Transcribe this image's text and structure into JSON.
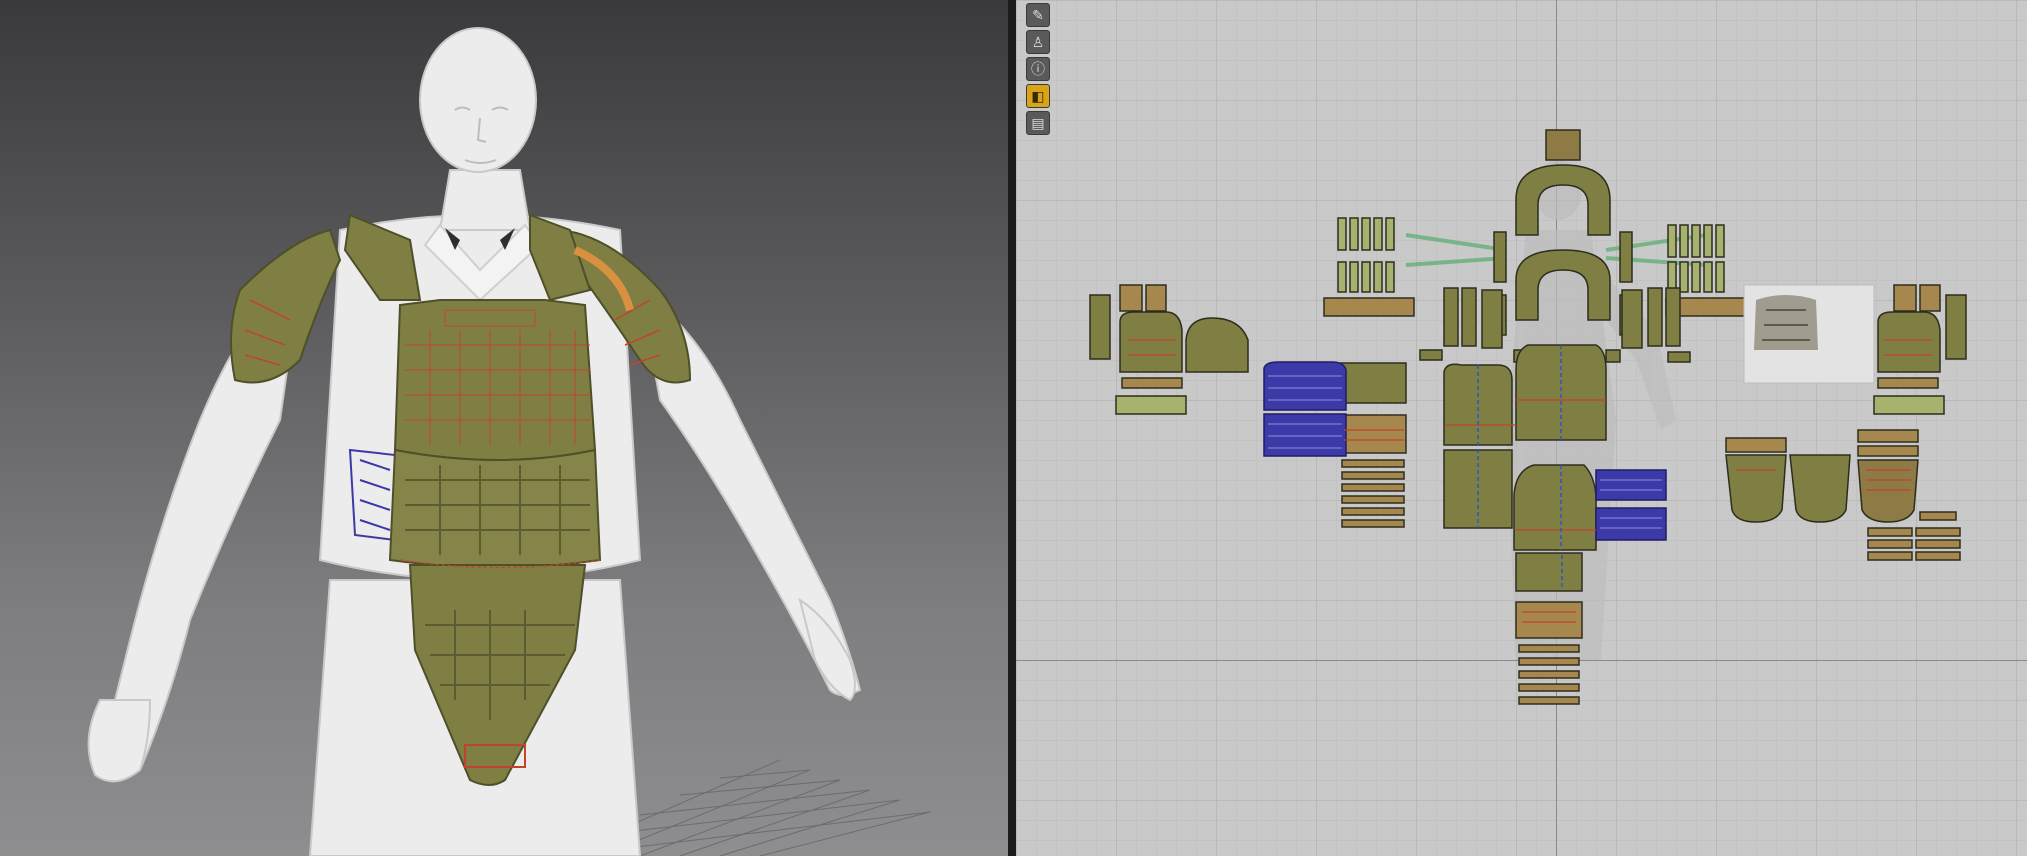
{
  "viewports": {
    "left": {
      "kind": "3d-avatar-view"
    },
    "right": {
      "kind": "2d-pattern-view"
    }
  },
  "toolbar": {
    "tools": [
      {
        "icon": "pen-icon"
      },
      {
        "icon": "shirt-icon"
      },
      {
        "icon": "info-icon"
      },
      {
        "icon": "texture-icon"
      },
      {
        "icon": "garment-icon"
      }
    ],
    "active_index": 3
  },
  "colors": {
    "fabric": "#7f7f44",
    "fabric_light": "#8d8d52",
    "seam": "#c0442b",
    "mesh": "#3c3aa8",
    "outline": "#2d2d1e",
    "highlight": "#5fae72",
    "avatar": "#e9e9e9"
  }
}
